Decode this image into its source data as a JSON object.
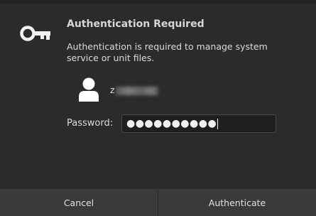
{
  "dialog": {
    "title": "Authentication Required",
    "message": "Authentication is required to manage system service or unit files.",
    "username_initial": "z",
    "password_label": "Password:",
    "password_mask": "●●●●●●●●●●",
    "cancel_label": "Cancel",
    "authenticate_label": "Authenticate"
  },
  "icons": {
    "key": "key-icon",
    "avatar": "user-avatar-icon"
  },
  "colors": {
    "background": "#2b2b2b",
    "button_background": "#3a3a3a",
    "input_background": "#1f1f1f",
    "text": "#dcdcdc"
  }
}
